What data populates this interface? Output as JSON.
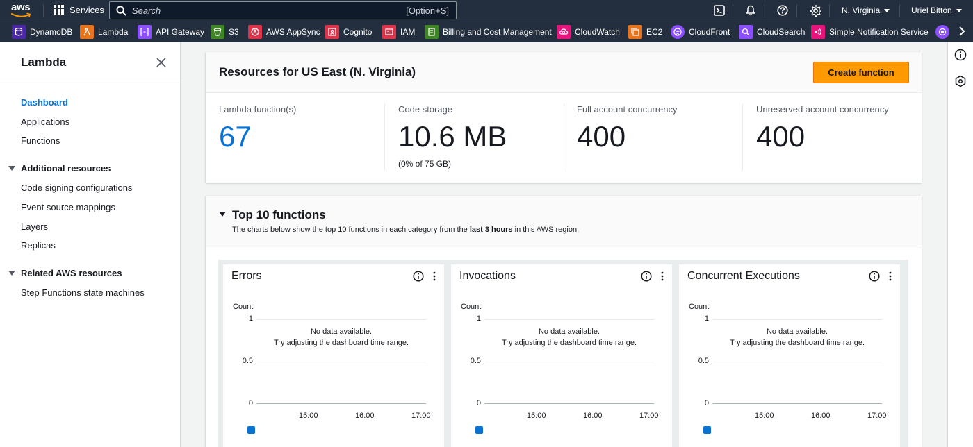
{
  "topnav": {
    "logo_text": "aws",
    "services_label": "Services",
    "search_placeholder": "Search",
    "search_shortcut": "[Option+S]",
    "region": "N. Virginia",
    "user": "Uriel Bitton"
  },
  "favorites": [
    {
      "label": "DynamoDB",
      "color": "#4d27aa",
      "icon": "dynamodb-icon"
    },
    {
      "label": "Lambda",
      "color": "#e7731b",
      "icon": "lambda-icon"
    },
    {
      "label": "API Gateway",
      "color": "#8c4fff",
      "icon": "api-gateway-icon"
    },
    {
      "label": "S3",
      "color": "#3f8624",
      "icon": "s3-icon"
    },
    {
      "label": "AWS AppSync",
      "color": "#dd344c",
      "icon": "appsync-icon"
    },
    {
      "label": "Cognito",
      "color": "#dd344c",
      "icon": "cognito-icon"
    },
    {
      "label": "IAM",
      "color": "#dd344c",
      "icon": "iam-icon"
    },
    {
      "label": "Billing and Cost Management",
      "color": "#3f8624",
      "icon": "billing-icon"
    },
    {
      "label": "CloudWatch",
      "color": "#e7157b",
      "icon": "cloudwatch-icon"
    },
    {
      "label": "EC2",
      "color": "#e7731b",
      "icon": "ec2-icon"
    },
    {
      "label": "CloudFront",
      "color": "#8c4fff",
      "icon": "cloudfront-icon"
    },
    {
      "label": "CloudSearch",
      "color": "#8c4fff",
      "icon": "cloudsearch-icon"
    },
    {
      "label": "Simple Notification Service",
      "color": "#e7157b",
      "icon": "sns-icon"
    }
  ],
  "sidenav": {
    "title": "Lambda",
    "items": [
      {
        "label": "Dashboard",
        "active": true
      },
      {
        "label": "Applications"
      },
      {
        "label": "Functions"
      }
    ],
    "section1": {
      "label": "Additional resources",
      "items": [
        "Code signing configurations",
        "Event source mappings",
        "Layers",
        "Replicas"
      ]
    },
    "section2": {
      "label": "Related AWS resources",
      "items": [
        "Step Functions state machines"
      ]
    }
  },
  "resources": {
    "title": "Resources for US East (N. Virginia)",
    "create_button": "Create function",
    "metrics": [
      {
        "label": "Lambda function(s)",
        "value": "67",
        "sub": ""
      },
      {
        "label": "Code storage",
        "value": "10.6 MB",
        "sub": "(0% of 75 GB)"
      },
      {
        "label": "Full account concurrency",
        "value": "400",
        "sub": ""
      },
      {
        "label": "Unreserved account concurrency",
        "value": "400",
        "sub": ""
      }
    ]
  },
  "top10": {
    "title": "Top 10 functions",
    "desc_before": "The charts below show the top 10 functions in each category from the ",
    "desc_bold": "last 3 hours",
    "desc_after": " in this AWS region.",
    "widgets": [
      {
        "title": "Errors"
      },
      {
        "title": "Invocations"
      },
      {
        "title": "Concurrent Executions"
      }
    ],
    "count_label": "Count",
    "no_data_1": "No data available.",
    "no_data_2": "Try adjusting the dashboard time range."
  },
  "chart_data": [
    {
      "type": "line",
      "title": "Errors",
      "ylabel": "Count",
      "ylim": [
        0,
        1
      ],
      "yticks": [
        "1",
        "0.5",
        "0"
      ],
      "xticks": [
        "15:00",
        "16:00",
        "17:00"
      ],
      "series": []
    },
    {
      "type": "line",
      "title": "Invocations",
      "ylabel": "Count",
      "ylim": [
        0,
        1
      ],
      "yticks": [
        "1",
        "0.5",
        "0"
      ],
      "xticks": [
        "15:00",
        "16:00",
        "17:00"
      ],
      "series": []
    },
    {
      "type": "line",
      "title": "Concurrent Executions",
      "ylabel": "Count",
      "ylim": [
        0,
        1
      ],
      "yticks": [
        "1",
        "0.5",
        "0"
      ],
      "xticks": [
        "15:00",
        "16:00",
        "17:00"
      ],
      "series": []
    }
  ]
}
